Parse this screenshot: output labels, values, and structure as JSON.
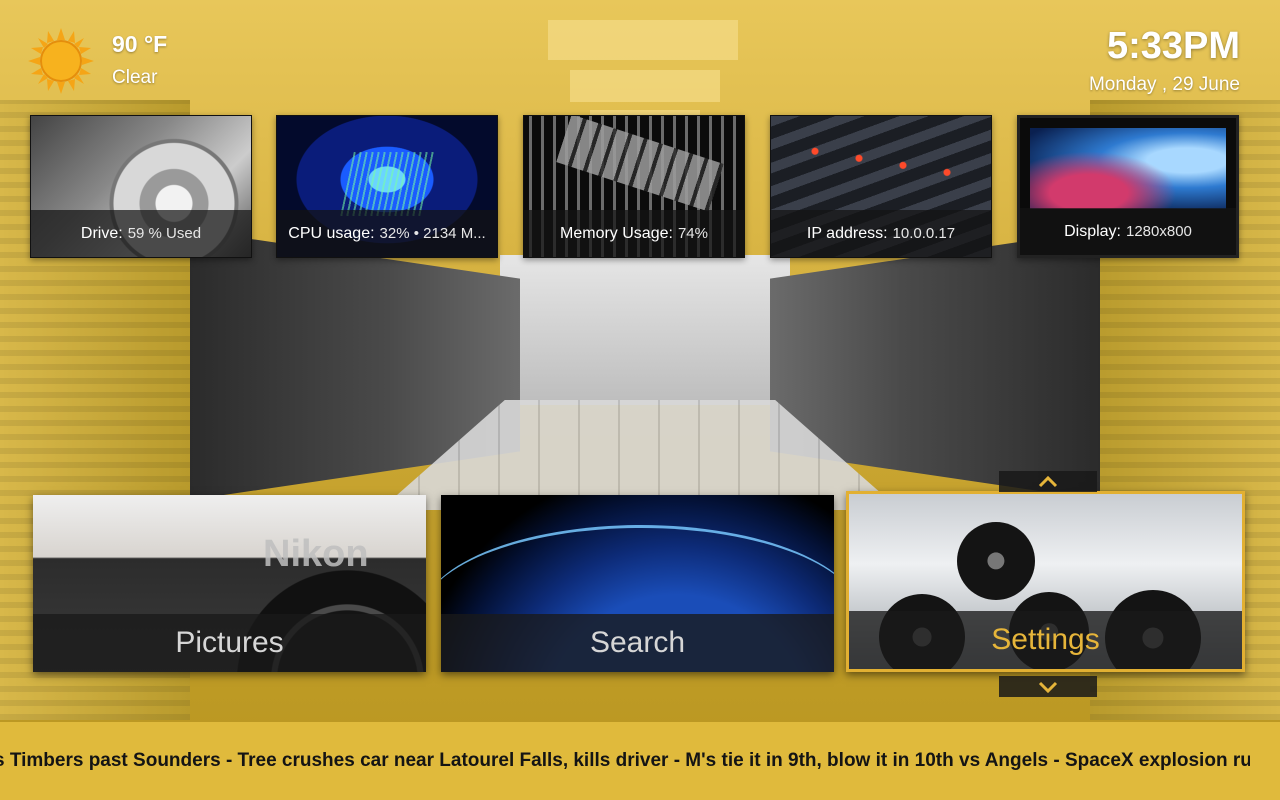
{
  "weather": {
    "icon": "sun-icon",
    "temperature": "90 °F",
    "condition": "Clear"
  },
  "clock": {
    "time": "5:33PM",
    "date": "Monday , 29 June"
  },
  "info_tiles": [
    {
      "key": "Drive:",
      "value": "59 % Used"
    },
    {
      "key": "CPU usage:",
      "value": "32% • 2134 M..."
    },
    {
      "key": "Memory Usage:",
      "value": "74%"
    },
    {
      "key": "IP address:",
      "value": "10.0.0.17"
    },
    {
      "key": "Display:",
      "value": "1280x800"
    }
  ],
  "menu": [
    {
      "label": "Pictures"
    },
    {
      "label": "Search"
    },
    {
      "label": "Settings",
      "focused": true
    }
  ],
  "ticker": {
    "text": "s Timbers past Sounders - Tree crushes car near Latourel Falls, kills driver - M's tie it in 9th, blow it in 10th vs Angels - SpaceX explosion ruins"
  },
  "colors": {
    "accent": "#e6b53a",
    "ticker_bg": "#e0ba3c",
    "tile_label_bg": "#191919"
  }
}
